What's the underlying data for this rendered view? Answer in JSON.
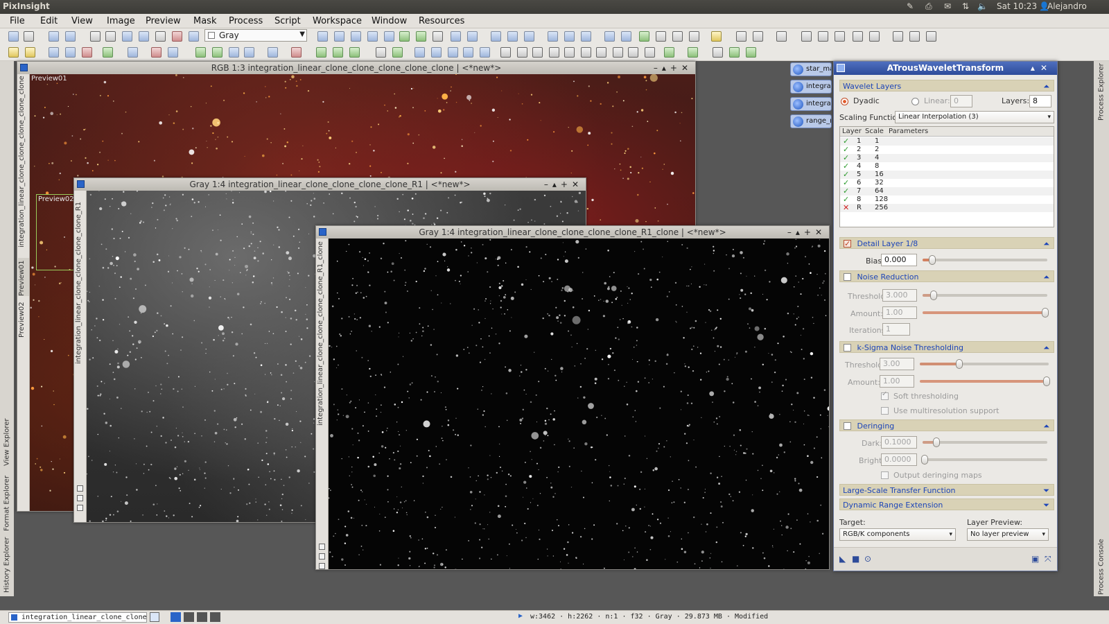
{
  "topbar": {
    "app": "PixInsight",
    "clock": "Sat 10:23",
    "user": "Alejandro"
  },
  "menu": [
    "File",
    "Edit",
    "View",
    "Image",
    "Preview",
    "Mask",
    "Process",
    "Script",
    "Workspace",
    "Window",
    "Resources"
  ],
  "toolbar": {
    "colorspace": "Gray"
  },
  "sidebar": {
    "left_tabs": [
      "View Explorer",
      "Format Explorer",
      "History Explorer"
    ],
    "right_tabs": [
      "Process Explorer",
      "Process Console"
    ]
  },
  "windows": {
    "rgb": {
      "title": "RGB 1:3 integration_linear_clone_clone_clone_clone_clone | <*new*>",
      "side_label": "integration_linear_clone_clone_clone_clone_clone",
      "preview1": "Preview01",
      "preview2": "Preview02",
      "tab1": "Preview01",
      "tab2": "Preview02"
    },
    "gray1": {
      "title": "Gray 1:4 integration_linear_clone_clone_clone_clone_R1 | <*new*>",
      "side_label": "integration_linear_clone_clone_clone_clone_R1"
    },
    "gray2": {
      "title": "Gray 1:4 integration_linear_clone_clone_clone_clone_R1_clone | <*new*>",
      "side_label": "integration_linear_clone_clone_clone_clone_R1_clone"
    }
  },
  "process_icons": [
    "star_ma",
    "integrat",
    "integrat",
    "range_m"
  ],
  "atrous": {
    "title": "ATrousWaveletTransform",
    "wavelet_layers": "Wavelet Layers",
    "dyadic": "Dyadic",
    "linear": "Linear:",
    "linear_value": "0",
    "layers_label": "Layers:",
    "layers_value": "8",
    "scaling_label": "Scaling Function:",
    "scaling_value": "Linear Interpolation (3)",
    "table_headers": [
      "Layer",
      "Scale",
      "Parameters"
    ],
    "rows": [
      {
        "layer": "1",
        "scale": "1",
        "on": true
      },
      {
        "layer": "2",
        "scale": "2",
        "on": true
      },
      {
        "layer": "3",
        "scale": "4",
        "on": true
      },
      {
        "layer": "4",
        "scale": "8",
        "on": true
      },
      {
        "layer": "5",
        "scale": "16",
        "on": true
      },
      {
        "layer": "6",
        "scale": "32",
        "on": true
      },
      {
        "layer": "7",
        "scale": "64",
        "on": true
      },
      {
        "layer": "8",
        "scale": "128",
        "on": true
      },
      {
        "layer": "R",
        "scale": "256",
        "on": false
      }
    ],
    "detail_layer": "Detail Layer 1/8",
    "bias_label": "Bias:",
    "bias_value": "0.000",
    "noise_reduction": "Noise Reduction",
    "threshold_label": "Threshold:",
    "nr_threshold": "3.000",
    "amount_label": "Amount:",
    "nr_amount": "1.00",
    "iterations_label": "Iterations:",
    "nr_iterations": "1",
    "ksigma": "k-Sigma Noise Thresholding",
    "ks_threshold": "3.00",
    "ks_amount": "1.00",
    "soft_threshold": "Soft thresholding",
    "multires": "Use multiresolution support",
    "deringing": "Deringing",
    "dark_label": "Dark:",
    "dark_value": "0.1000",
    "bright_label": "Bright:",
    "bright_value": "0.0000",
    "output_maps": "Output deringing maps",
    "lstf": "Large-Scale Transfer Function",
    "dre": "Dynamic Range Extension",
    "target_label": "Target:",
    "target_value": "RGB/K components",
    "preview_label": "Layer Preview:",
    "preview_value": "No layer preview"
  },
  "statusbar": {
    "view": "integration_linear_clone_clone_(",
    "info": "w:3462 · h:2262 · n:1 · f32 · Gray · 29.873 MB · Modified"
  },
  "colors": {
    "accent": "#2d4b9a",
    "section_bg": "#d9d2b6",
    "section_text": "#1d45b8"
  }
}
